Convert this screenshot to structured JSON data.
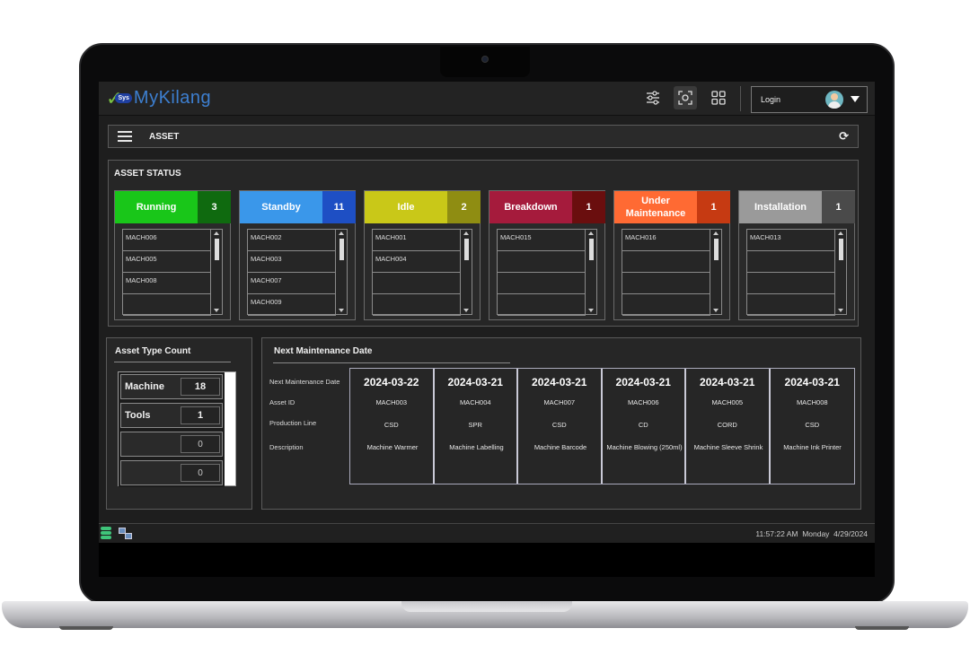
{
  "app": {
    "logo_badge": "Sys",
    "logo_text": "MyKilang",
    "brand_color": "#3d7fd0",
    "icons": [
      "filter-sliders-icon",
      "screen-capture-icon",
      "grid-layout-icon"
    ]
  },
  "login": {
    "label": "Login"
  },
  "header": {
    "title": "ASSET",
    "refresh_icon": "refresh-icon"
  },
  "asset_status": {
    "title": "ASSET STATUS",
    "cards": [
      {
        "label": "Running",
        "count": "3",
        "head_color": "#19c619",
        "count_color": "#0f6a0f",
        "items": [
          "MACH006",
          "MACH005",
          "MACH008",
          ""
        ]
      },
      {
        "label": "Standby",
        "count": "11",
        "head_color": "#3a97ea",
        "count_color": "#1e4fc4",
        "items": [
          "MACH002",
          "MACH003",
          "MACH007",
          "MACH009"
        ]
      },
      {
        "label": "Idle",
        "count": "2",
        "head_color": "#c9c818",
        "count_color": "#8f8d12",
        "items": [
          "MACH001",
          "MACH004",
          "",
          ""
        ]
      },
      {
        "label": "Breakdown",
        "count": "1",
        "head_color": "#a51b3c",
        "count_color": "#6a0e0e",
        "items": [
          "MACH015",
          "",
          "",
          ""
        ]
      },
      {
        "label": "Under Maintenance",
        "count": "1",
        "head_color": "#ff6a33",
        "count_color": "#c63a12",
        "items": [
          "MACH016",
          "",
          "",
          ""
        ]
      },
      {
        "label": "Installation",
        "count": "1",
        "head_color": "#9a9a9a",
        "count_color": "#4a4a4a",
        "items": [
          "MACH013",
          "",
          "",
          ""
        ]
      }
    ]
  },
  "asset_type": {
    "title": "Asset Type Count",
    "rows": [
      {
        "label": "Machine",
        "count": "18"
      },
      {
        "label": "Tools",
        "count": "1"
      },
      {
        "label": "",
        "count": "0"
      },
      {
        "label": "",
        "count": "0"
      }
    ]
  },
  "maintenance": {
    "title": "Next Maintenance Date",
    "labels": [
      "Next Maintenance Date",
      "Asset ID",
      "Production Line",
      "Description"
    ],
    "columns": [
      {
        "date": "2024-03-22",
        "asset": "MACH003",
        "line": "CSD",
        "desc": "Machine Warmer"
      },
      {
        "date": "2024-03-21",
        "asset": "MACH004",
        "line": "SPR",
        "desc": "Machine Labelling"
      },
      {
        "date": "2024-03-21",
        "asset": "MACH007",
        "line": "CSD",
        "desc": "Machine Barcode"
      },
      {
        "date": "2024-03-21",
        "asset": "MACH006",
        "line": "CD",
        "desc": "Machine Blowing (250ml)"
      },
      {
        "date": "2024-03-21",
        "asset": "MACH005",
        "line": "CORD",
        "desc": "Machine Sleeve Shrink"
      },
      {
        "date": "2024-03-21",
        "asset": "MACH008",
        "line": "CSD",
        "desc": "Machine Ink Printer"
      }
    ]
  },
  "statusbar": {
    "time": "11:57:22 AM",
    "day": "Monday",
    "date": "4/29/2024"
  }
}
